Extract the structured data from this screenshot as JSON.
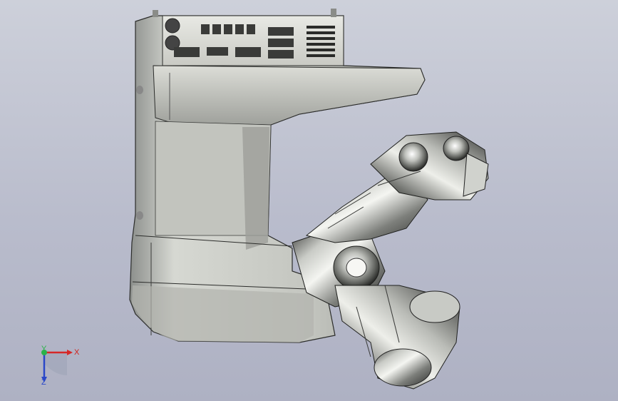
{
  "viewport": {
    "background_top": "#cdd0da",
    "background_bottom": "#aeb1c3"
  },
  "model": {
    "description_icon": "robot-3d-model"
  },
  "triad": {
    "x_label": "X",
    "y_label": "Y",
    "z_label": "Z",
    "x_color": "#d62828",
    "y_color": "#2bb34a",
    "z_color": "#2a47c8"
  }
}
